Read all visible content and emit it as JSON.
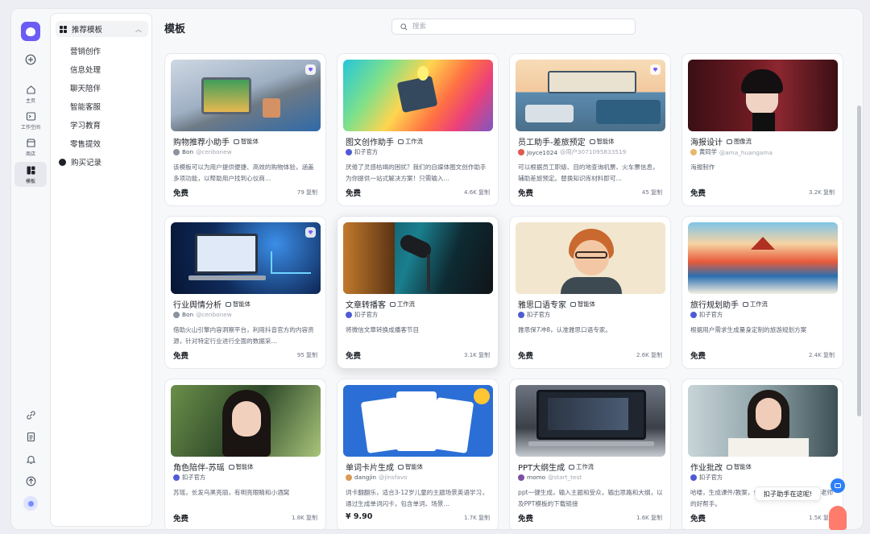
{
  "rail": {
    "items": [
      {
        "label": "主页",
        "icon": "home-icon"
      },
      {
        "label": "工作空间",
        "icon": "workspace-icon"
      },
      {
        "label": "商店",
        "icon": "store-icon"
      },
      {
        "label": "模板",
        "icon": "template-icon"
      }
    ]
  },
  "sidebar": {
    "section": "推荐模板",
    "subitems": [
      "营销创作",
      "信息处理",
      "聊天陪伴",
      "智能客服",
      "学习教育",
      "零售提效"
    ],
    "history": "购买记录"
  },
  "main": {
    "title": "模板",
    "search_placeholder": "搜索"
  },
  "colors": {
    "accent": "#6b5cf6",
    "help": "#2d7ff9"
  },
  "cards": [
    {
      "name": "购物推荐小助手",
      "tag": "智能体",
      "author": "Bon",
      "handle": "@cenbonew",
      "desc": "该模板可以为用户提供便捷、高效的购物体验，涵盖多项功能，以帮助用户找到心仪商…",
      "price": "免费",
      "copies": "79 复制"
    },
    {
      "name": "图文创作助手",
      "tag": "工作流",
      "author": "扣子官方",
      "handle": "",
      "desc": "厌倦了灵感枯竭的困扰？我们的自媒体图文创作助手为你提供一站式解决方案！只需输入…",
      "price": "免费",
      "copies": "4.6K 复制"
    },
    {
      "name": "员工助手-差旅预定",
      "tag": "智能体",
      "author": "Joyce1024",
      "handle": "@用户3071095833519",
      "desc": "可以根据员工职级、目的地查询机票、火车票信息，辅助差旅预定。替换知识库材料即可…",
      "price": "免费",
      "copies": "45 复制"
    },
    {
      "name": "海报设计",
      "tag": "图像流",
      "author": "黄同学",
      "handle": "@ama_huangama",
      "desc": "海报制作",
      "price": "免费",
      "copies": "3.2K 复制"
    },
    {
      "name": "行业舆情分析",
      "tag": "智能体",
      "author": "Bon",
      "handle": "@cenbonew",
      "desc": "借助火山引擎内容洞察平台，利用抖音官方的内容资源，针对特定行业进行全面的数据采…",
      "price": "免费",
      "copies": "95 复制"
    },
    {
      "name": "文章转播客",
      "tag": "工作流",
      "author": "扣子官方",
      "handle": "",
      "desc": "将微信文章转换成播客节目",
      "price": "免费",
      "copies": "3.1K 复制"
    },
    {
      "name": "雅思口语专家",
      "tag": "智能体",
      "author": "扣子官方",
      "handle": "",
      "desc": "雅思保7冲8，认准雅思口语专家。",
      "price": "免费",
      "copies": "2.6K 复制"
    },
    {
      "name": "旅行规划助手",
      "tag": "工作流",
      "author": "扣子官方",
      "handle": "",
      "desc": "根据用户需求生成量身定制的旅游规划方案",
      "price": "免费",
      "copies": "2.4K 复制"
    },
    {
      "name": "角色陪伴-苏瑶",
      "tag": "智能体",
      "author": "扣子官方",
      "handle": "",
      "desc": "苏瑶，长发乌黑亮丽，有明亮眼睛和小酒窝",
      "price": "免费",
      "copies": "1.8K 复制"
    },
    {
      "name": "单词卡片生成",
      "tag": "智能体",
      "author": "dangjin",
      "handle": "@jinsfavo",
      "desc": "词卡翻翻乐，适合3-12岁儿童的主题场景英语学习，通过生成单词闪卡，包含单词、场景…",
      "price": "¥ 9.90",
      "copies": "1.7K 复制"
    },
    {
      "name": "PPT大纲生成",
      "tag": "工作流",
      "author": "momo",
      "handle": "@start_test",
      "desc": "ppt一键生成，输入主题和受众，输出思路和大纲，以及PPT模板的下载链接",
      "price": "免费",
      "copies": "1.6K 复制"
    },
    {
      "name": "作业批改",
      "tag": "智能体",
      "author": "扣子官方",
      "handle": "",
      "desc": "哈喽，生成课件/教案，作业批改，我，我是历史老师的好帮手。",
      "price": "免费",
      "copies": "1.5K 复制"
    }
  ],
  "assistant_bubble": "扣子助手在这呢!"
}
